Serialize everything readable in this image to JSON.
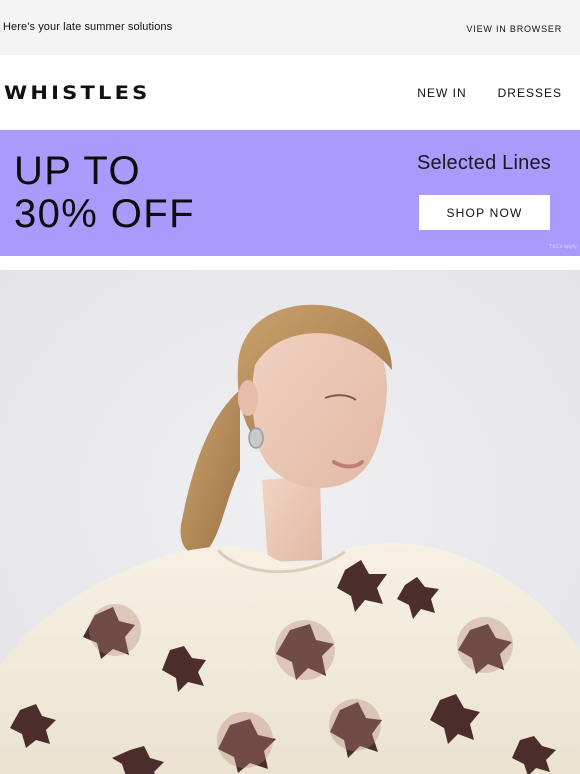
{
  "preheader": {
    "intro_text": "Here's your late summer solutions",
    "view_in_browser": "VIEW IN BROWSER"
  },
  "header": {
    "logo_text": "WHISTLES",
    "nav": [
      {
        "label": "NEW IN"
      },
      {
        "label": "DRESSES"
      }
    ]
  },
  "promo": {
    "headline_line1": "UP TO",
    "headline_line2": "30% OFF",
    "subtitle": "Selected Lines",
    "cta_label": "SHOP NOW",
    "terms": "T&Cs apply",
    "background_color": "#a99afc"
  },
  "hero": {
    "background_color": "#e9e9ed",
    "top_color": "#f3eee1",
    "print_color": "#3a1a1a"
  }
}
